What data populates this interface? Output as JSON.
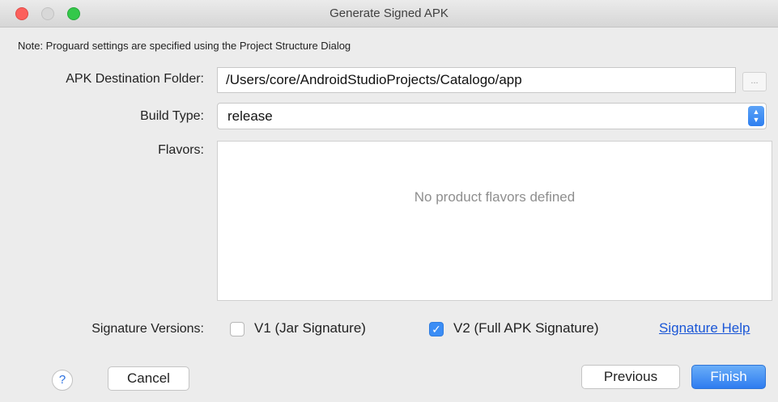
{
  "window": {
    "title": "Generate Signed APK"
  },
  "note": "Note: Proguard settings are specified using the Project Structure Dialog",
  "destination": {
    "label": "APK Destination Folder:",
    "value": "/Users/core/AndroidStudioProjects/Catalogo/app",
    "browse_label": "..."
  },
  "build_type": {
    "label": "Build Type:",
    "value": "release"
  },
  "flavors": {
    "label": "Flavors:",
    "empty_text": "No product flavors defined"
  },
  "signature": {
    "label": "Signature Versions:",
    "v1": {
      "label": "V1 (Jar Signature)",
      "checked": false
    },
    "v2": {
      "label": "V2 (Full APK Signature)",
      "checked": true
    },
    "help_link": "Signature Help"
  },
  "buttons": {
    "help": "?",
    "cancel": "Cancel",
    "previous": "Previous",
    "finish": "Finish"
  },
  "colors": {
    "accent": "#3b8df5",
    "link": "#1a56d6",
    "close": "#fc605c",
    "maximize": "#34c84a"
  }
}
